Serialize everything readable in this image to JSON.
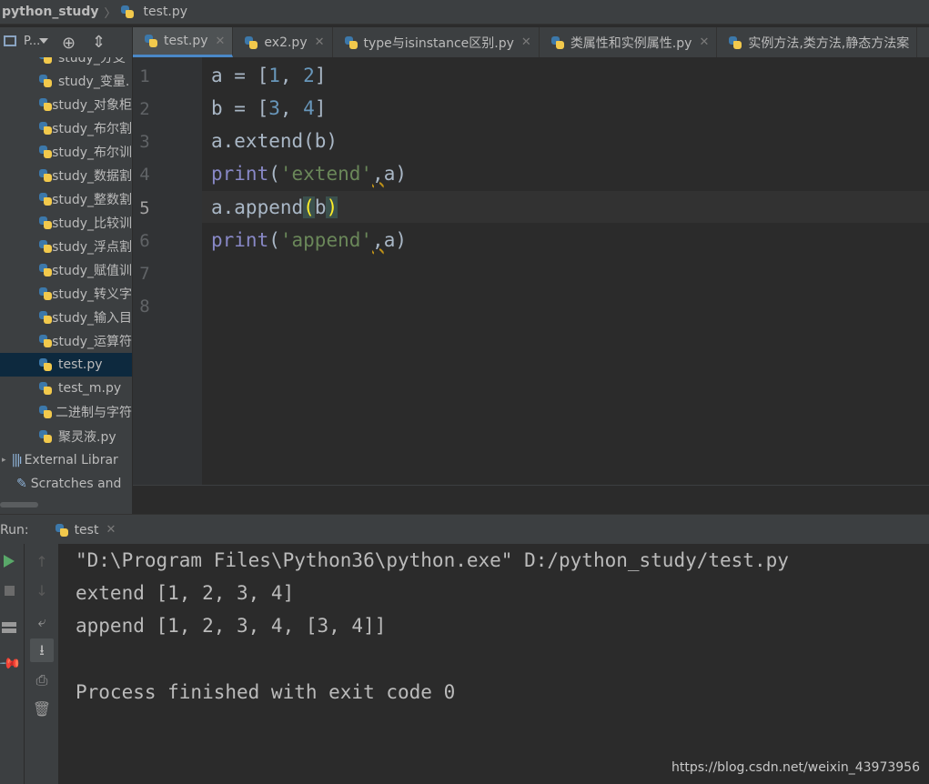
{
  "navbar": {
    "project": "python_study",
    "file": "test.py"
  },
  "project_toolbar": {
    "label": "P..."
  },
  "tabs": [
    {
      "label": "test.py",
      "active": true
    },
    {
      "label": "ex2.py",
      "active": false
    },
    {
      "label": "type与isinstance区别.py",
      "active": false
    },
    {
      "label": "类属性和实例属性.py",
      "active": false
    },
    {
      "label": "实例方法,类方法,静态方法案",
      "active": false
    }
  ],
  "tree": {
    "items": [
      "study_分支",
      "study_变量.",
      "study_对象柜",
      "study_布尔割",
      "study_布尔训",
      "study_数据割",
      "study_整数割",
      "study_比较训",
      "study_浮点割",
      "study_赋值训",
      "study_转义字",
      "study_输入目",
      "study_运算符",
      "test.py",
      "test_m.py",
      "二进制与字符",
      "聚灵液.py"
    ],
    "selected": "test.py",
    "external": "External Librar",
    "scratches": "Scratches and"
  },
  "editor": {
    "line_numbers": [
      "1",
      "2",
      "3",
      "4",
      "5",
      "6",
      "7",
      "8"
    ],
    "current_line": "5"
  },
  "run": {
    "label": "Run:",
    "tab": "test",
    "output": [
      "\"D:\\Program Files\\Python36\\python.exe\" D:/python_study/test.py",
      "extend [1, 2, 3, 4]",
      "append [1, 2, 3, 4, [3, 4]]",
      "",
      "Process finished with exit code 0"
    ]
  },
  "watermark": "https://blog.csdn.net/weixin_43973956"
}
